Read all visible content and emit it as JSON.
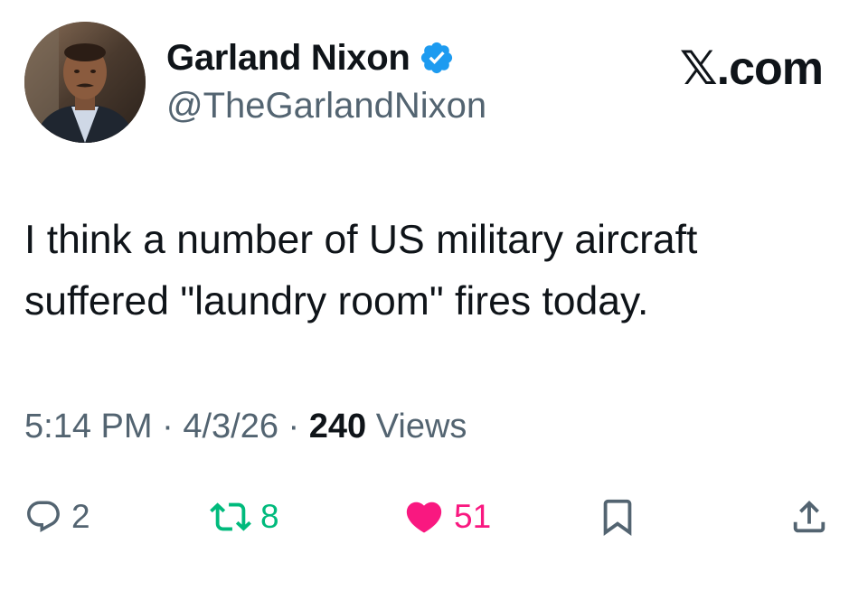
{
  "author": {
    "display_name": "Garland Nixon",
    "handle": "@TheGarlandNixon",
    "verified": true
  },
  "brand": {
    "x_glyph": "𝕏",
    "suffix": ".com"
  },
  "tweet": {
    "text_line1": "I think a number of US military aircraft",
    "text_line2": "suffered \"laundry room\" fires today."
  },
  "meta": {
    "time": "5:14 PM",
    "sep1": " · ",
    "date": "4/3/26",
    "sep2": " · ",
    "views_count": "240",
    "views_label": " Views"
  },
  "actions": {
    "replies": "2",
    "reposts": "8",
    "likes": "51"
  },
  "icons": {
    "reply": "reply-icon",
    "repost": "repost-icon",
    "like": "heart-icon",
    "bookmark": "bookmark-icon",
    "share": "share-icon",
    "verified": "verified-badge-icon"
  },
  "colors": {
    "text": "#0f1419",
    "secondary": "#536471",
    "verified": "#1d9bf0",
    "repost": "#00ba7c",
    "like": "#f91880"
  }
}
